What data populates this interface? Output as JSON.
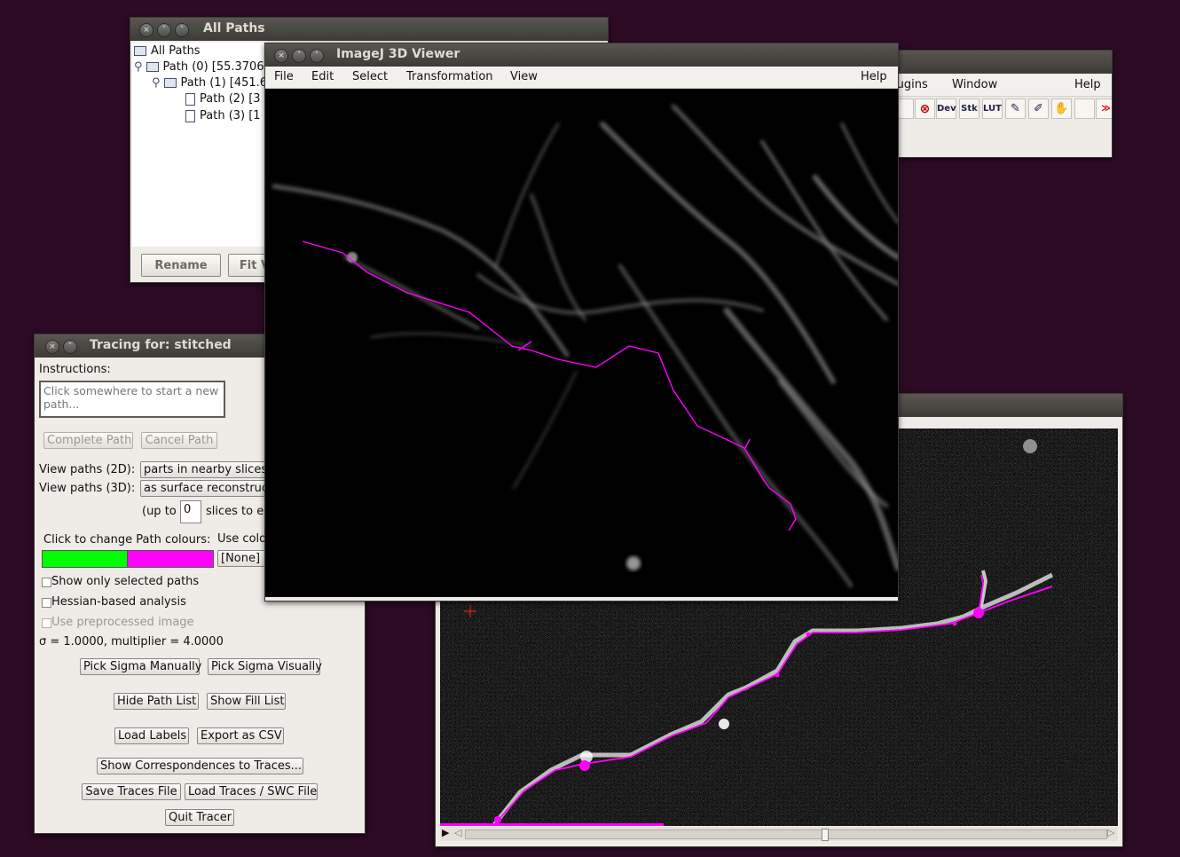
{
  "all_paths_window": {
    "title": "All Paths",
    "tree": [
      "All Paths",
      "Path (0) [55.3706",
      "Path (1) [451.6",
      "Path (2) [3",
      "Path (3) [1"
    ],
    "rename_button": "Rename",
    "fit_button": "Fit V"
  },
  "imagej_window": {
    "menu": {
      "plugins": "lugins",
      "window": "Window",
      "help": "Help"
    },
    "tools": [
      "Dev",
      "Stk",
      "LUT"
    ]
  },
  "viewer_window": {
    "title": "ImageJ 3D Viewer",
    "menu": [
      "File",
      "Edit",
      "Select",
      "Transformation",
      "View"
    ],
    "help": "Help"
  },
  "tracing_window": {
    "title": "Tracing for: stitched",
    "instructions_label": "Instructions:",
    "instructions_text": "Click somewhere to start a new path...",
    "complete_path": "Complete Path",
    "cancel_path": "Cancel Path",
    "view_2d_label": "View paths (2D):",
    "view_2d_value": "parts in nearby slices",
    "view_3d_label": "View paths (3D):",
    "view_3d_value": "as surface reconstructi",
    "up_to_label": "(up to",
    "up_to_value": "0",
    "slices_label": "slices to e",
    "colours_label": "Click to change Path colours:",
    "use_colour_label": "Use colo",
    "use_colour_value": "[None]",
    "colour_selected": "#00ff00",
    "colour_other": "#ff00ff",
    "show_selected": "Show only selected paths",
    "hessian": "Hessian-based analysis",
    "preprocessed": "Use preprocessed image",
    "sigma_text": "σ = 1.0000, multiplier = 4.0000",
    "pick_sigma_manually": "Pick Sigma Manually",
    "pick_sigma_visually": "Pick Sigma Visually",
    "hide_path_list": "Hide Path List",
    "show_fill_list": "Show Fill List",
    "load_labels": "Load Labels",
    "export_csv": "Export as CSV",
    "show_correspondences": "Show Correspondences to Traces...",
    "save_traces": "Save Traces File",
    "load_traces": "Load Traces / SWC File",
    "quit_tracer": "Quit Tracer"
  },
  "stack_window": {
    "slice_progress_fraction": 0.33
  }
}
